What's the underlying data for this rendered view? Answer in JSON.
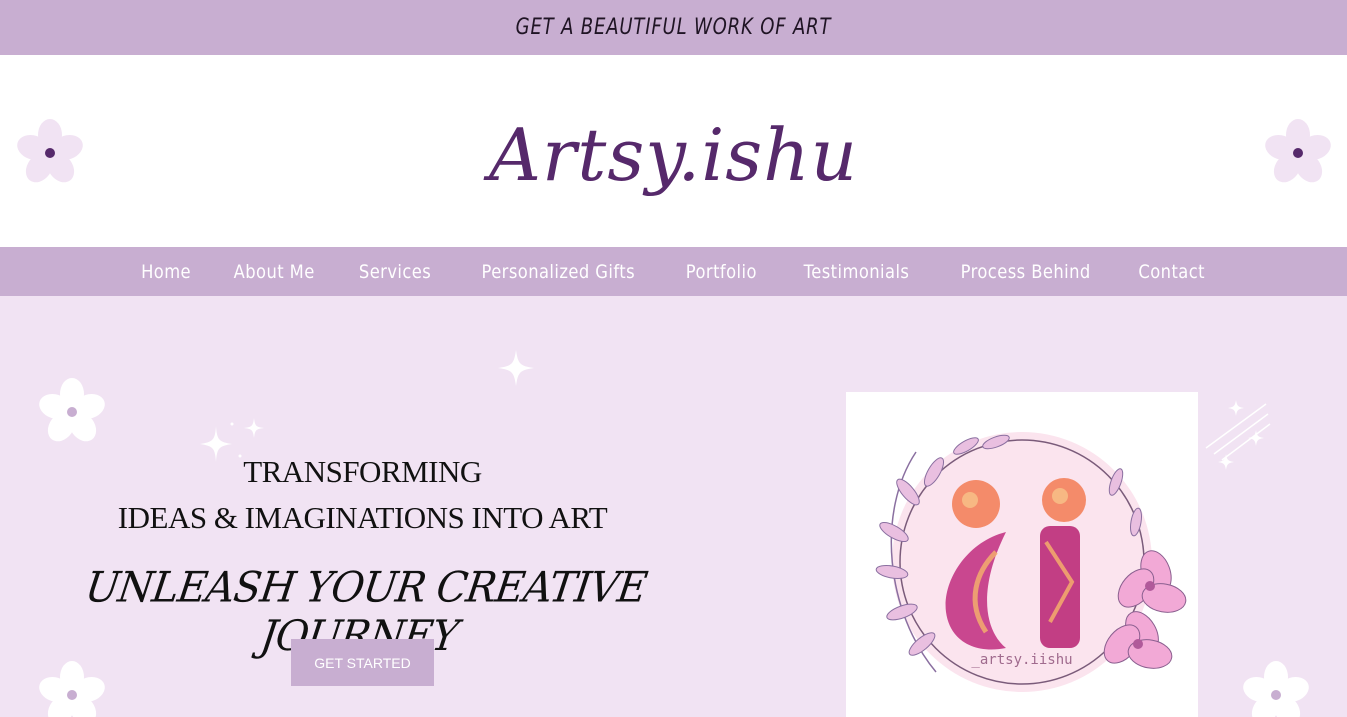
{
  "announcement": {
    "text": "GET A BEAUTIFUL WORK OF ART"
  },
  "header": {
    "logo_text": "Artsy.ishu"
  },
  "nav": {
    "items": [
      {
        "label": "Home"
      },
      {
        "label": "About Me"
      },
      {
        "label": "Services"
      },
      {
        "label": "Personalized Gifts"
      },
      {
        "label": "Portfolio"
      },
      {
        "label": "Testimonials"
      },
      {
        "label": "Process Behind"
      },
      {
        "label": "Contact"
      }
    ]
  },
  "hero": {
    "line1": "TRANSFORMING",
    "line2": "IDEAS & IMAGINATIONS INTO ART",
    "tagline": "UNLEASH YOUR CREATIVE JOURNEY",
    "cta_label": "GET STARTED",
    "logo_handle": "_artsy.iishu",
    "logo_letters": "ci"
  },
  "icons": {
    "header_flower": "flower-icon",
    "sparkle": "sparkle-icon"
  },
  "colors": {
    "accent": "#c8aed1",
    "brand": "#56296b",
    "hero_bg": "#f1e3f3",
    "white": "#ffffff"
  }
}
